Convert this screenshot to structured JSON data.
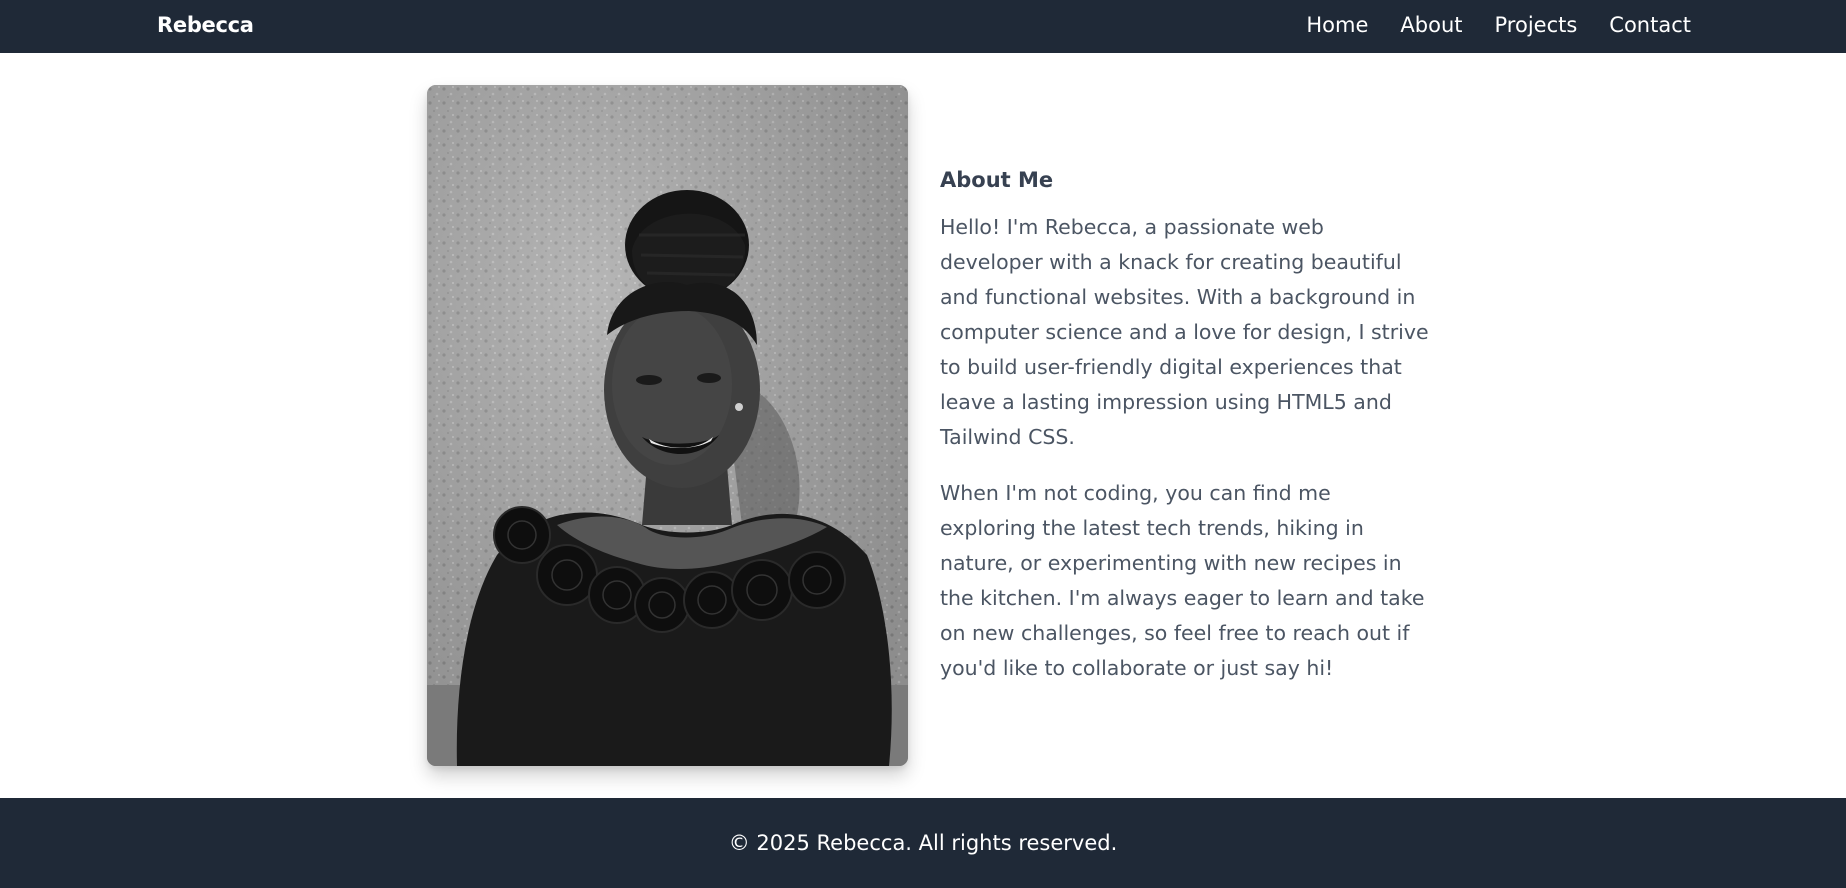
{
  "header": {
    "brand": "Rebecca",
    "nav": [
      {
        "label": "Home"
      },
      {
        "label": "About"
      },
      {
        "label": "Projects"
      },
      {
        "label": "Contact"
      }
    ],
    "background": "#1f2937"
  },
  "about": {
    "title": "About Me",
    "paragraphs": [
      "Hello! I'm Rebecca, a passionate web developer with a knack for creating beautiful and functional websites. With a background in computer science and a love for design, I strive to build user-friendly digital experiences that leave a lasting impression using HTML5 and Tailwind CSS.",
      "When I'm not coding, you can find me exploring the latest tech trends, hiking in nature, or experimenting with new recipes in the kitchen. I'm always eager to learn and take on new challenges, so feel free to reach out if you'd like to collaborate or just say hi!"
    ]
  },
  "footer": {
    "text": "© 2025 Rebecca. All rights reserved."
  },
  "colors": {
    "dark": "#1f2937",
    "text": "#4b5563",
    "heading": "#374151"
  }
}
